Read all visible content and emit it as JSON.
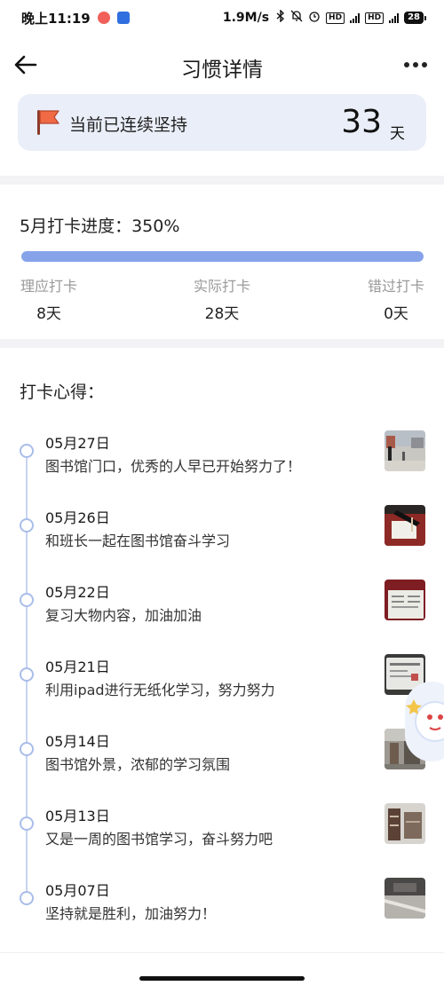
{
  "status_bar": {
    "time": "晚上11:19",
    "speed": "1.9M/s",
    "network": "4G",
    "battery": "28"
  },
  "header": {
    "title": "习惯详情"
  },
  "streak": {
    "label": "当前已连续坚持",
    "value": "33",
    "unit": "天"
  },
  "progress": {
    "title": "5月打卡进度：350%",
    "fill_fraction": 1.0,
    "stats": [
      {
        "label": "理应打卡",
        "value": "8天"
      },
      {
        "label": "实际打卡",
        "value": "28天"
      },
      {
        "label": "错过打卡",
        "value": "0天"
      }
    ]
  },
  "notes": {
    "title": "打卡心得：",
    "entries": [
      {
        "date": "05月27日",
        "text": "图书馆门口，优秀的人早已开始努力了！",
        "thumb": "plaza-photo"
      },
      {
        "date": "05月26日",
        "text": "和班长一起在图书馆奋斗学习",
        "thumb": "desk-writing-photo"
      },
      {
        "date": "05月22日",
        "text": "复习大物内容，加油加油",
        "thumb": "textbook-photo"
      },
      {
        "date": "05月21日",
        "text": "利用ipad进行无纸化学习，努力努力",
        "thumb": "ipad-photo"
      },
      {
        "date": "05月14日",
        "text": "图书馆外景，浓郁的学习氛围",
        "thumb": "library-exterior-photo"
      },
      {
        "date": "05月13日",
        "text": "又是一周的图书馆学习，奋斗努力吧",
        "thumb": "library-shelf-photo"
      },
      {
        "date": "05月07日",
        "text": "坚持就是胜利，加油努力！",
        "thumb": "corridor-photo"
      }
    ]
  },
  "colors": {
    "accent": "#86a3e9",
    "card_bg": "#e9eef8",
    "flag": "#e8603c"
  }
}
